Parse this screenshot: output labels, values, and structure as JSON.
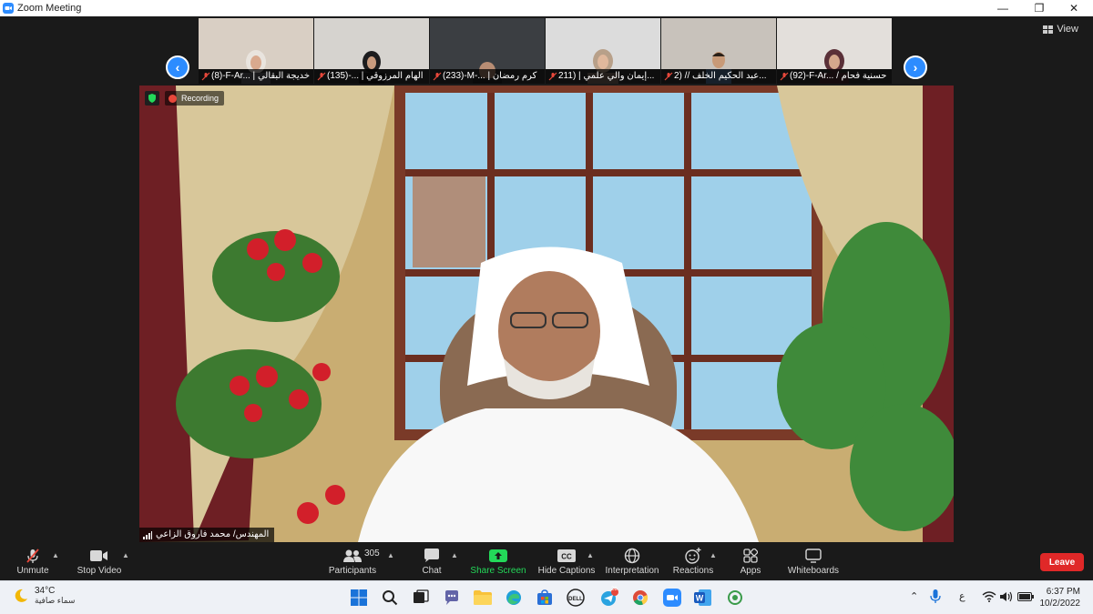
{
  "window": {
    "title": "Zoom Meeting",
    "minimize_icon": "minimize-icon",
    "maximize_icon": "restore-icon",
    "close_icon": "close-icon"
  },
  "gallery": {
    "view_label": "View",
    "participants": [
      {
        "label": "(8)-F-Ar... | خديجة البقالي"
      },
      {
        "label": "(135)-... | الهام المرزوقي"
      },
      {
        "label": "(233)-M-... | كرم رمضان"
      },
      {
        "label": "211) | إيمان والي علمي..."
      },
      {
        "label": "2) // عبد الحكيم الخلف..."
      },
      {
        "label": "(92)-F-Ar... / حسنية فحام"
      }
    ]
  },
  "main_video": {
    "recording_label": "Recording",
    "speaker_name": "المهندس/ محمد فاروق الزاعي"
  },
  "toolbar": {
    "unmute": "Unmute",
    "stop_video": "Stop Video",
    "participants": "Participants",
    "participants_count": "305",
    "chat": "Chat",
    "share_screen": "Share Screen",
    "hide_captions": "Hide Captions",
    "interpretation": "Interpretation",
    "reactions": "Reactions",
    "apps": "Apps",
    "whiteboards": "Whiteboards",
    "leave": "Leave"
  },
  "taskbar": {
    "temperature": "34°C",
    "condition": "سماء صافية",
    "language": "ع",
    "telegram_badge": "28",
    "time": "6:37 PM",
    "date": "10/2/2022"
  },
  "colors": {
    "zoom_blue": "#2d8cff",
    "leave_red": "#e02828",
    "share_green": "#23d959",
    "mic_off_red": "#e8483b"
  }
}
